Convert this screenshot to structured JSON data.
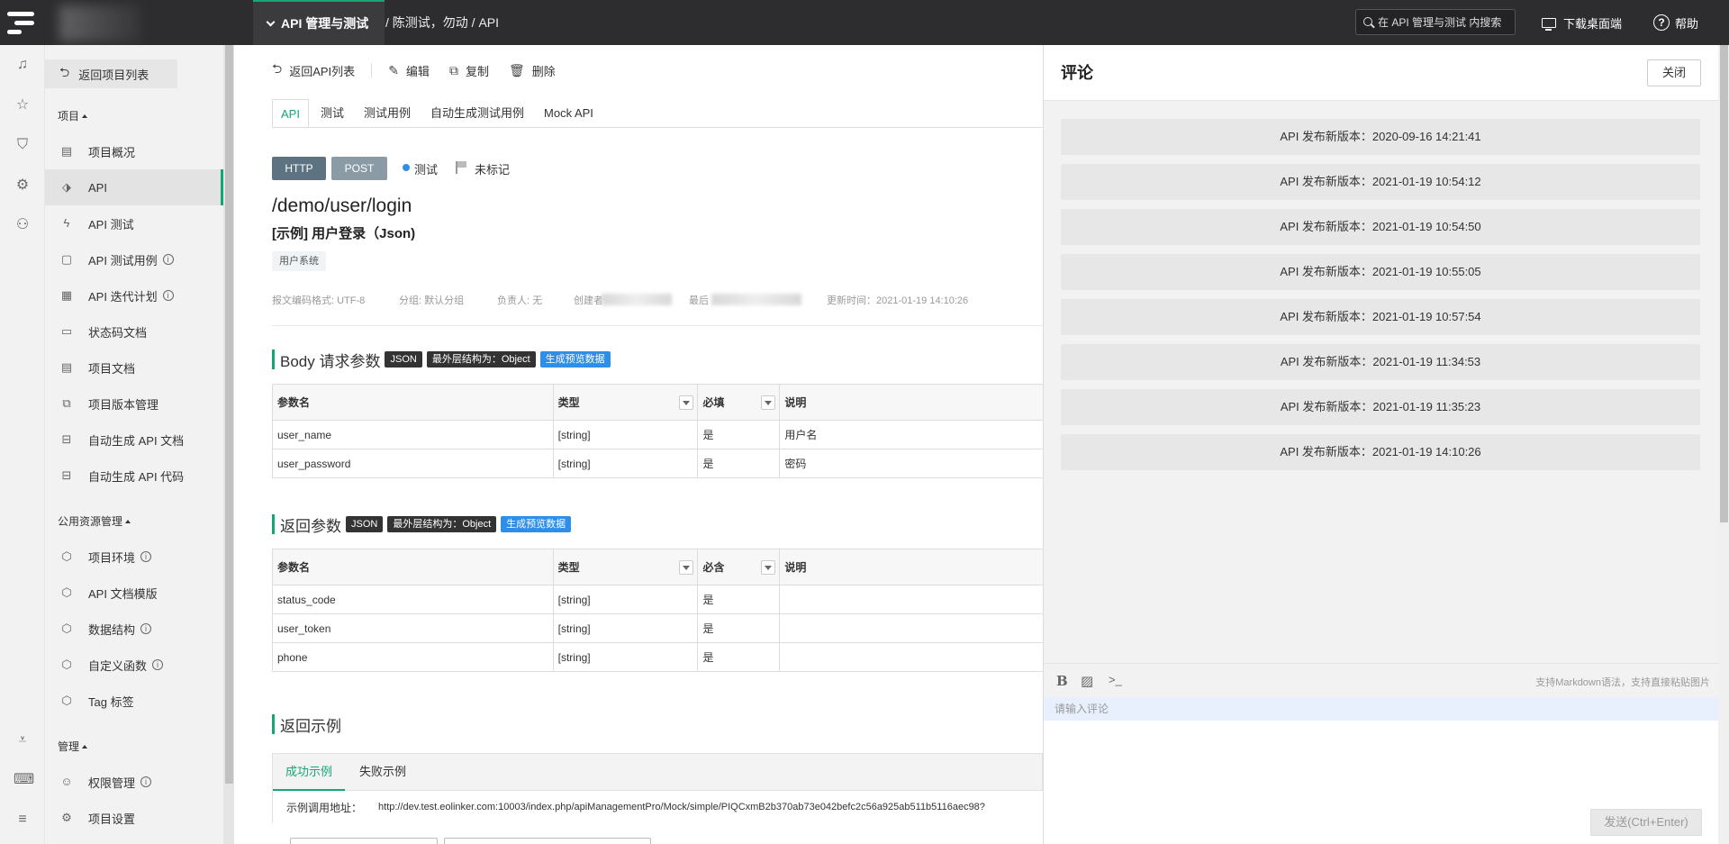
{
  "topbar": {
    "module": "API 管理与测试",
    "breadcrumb": "/ 陈测试，勿动 / API",
    "search_placeholder": "在 API 管理与测试 内搜索",
    "download_label": "下载桌面端",
    "help_label": "帮助"
  },
  "sidebar": {
    "back_label": "返回项目列表",
    "section_project": "项目",
    "section_resources": "公用资源管理",
    "section_manage": "管理",
    "items": [
      {
        "label": "项目概况",
        "info": false
      },
      {
        "label": "API",
        "info": false,
        "active": true
      },
      {
        "label": "API 测试",
        "info": false
      },
      {
        "label": "API 测试用例",
        "info": true
      },
      {
        "label": "API 迭代计划",
        "info": true
      },
      {
        "label": "状态码文档",
        "info": false
      },
      {
        "label": "项目文档",
        "info": false
      },
      {
        "label": "项目版本管理",
        "info": false
      },
      {
        "label": "自动生成 API 文档",
        "info": false
      },
      {
        "label": "自动生成 API 代码",
        "info": false
      }
    ],
    "resource_items": [
      {
        "label": "项目环境",
        "info": true
      },
      {
        "label": "API 文档模版",
        "info": false
      },
      {
        "label": "数据结构",
        "info": true
      },
      {
        "label": "自定义函数",
        "info": true
      },
      {
        "label": "Tag 标签",
        "info": false
      }
    ],
    "manage_items": [
      {
        "label": "权限管理",
        "info": true
      },
      {
        "label": "项目设置",
        "info": false
      }
    ]
  },
  "toolbar": {
    "back": "返回API列表",
    "edit": "编辑",
    "copy": "复制",
    "delete": "删除"
  },
  "tabs": [
    "API",
    "测试",
    "测试用例",
    "自动生成测试用例",
    "Mock API"
  ],
  "api": {
    "protocol": "HTTP",
    "method": "POST",
    "status": "测试",
    "mark": "未标记",
    "path": "/demo/user/login",
    "name": "[示例] 用户登录（Json)",
    "tag": "用户系统",
    "meta": {
      "encoding": "报文编码格式: UTF-8",
      "group": "分组: 默认分组",
      "owner": "负责人: 无",
      "creator": "创建者",
      "last": "最后",
      "updated": "更新时间：2021-01-19 14:10:26"
    }
  },
  "body_params": {
    "title": "Body 请求参数",
    "pills": [
      "JSON",
      "最外层结构为：Object",
      "生成预览数据"
    ],
    "headers": [
      "参数名",
      "类型",
      "必填",
      "说明"
    ],
    "rows": [
      [
        "user_name",
        "[string]",
        "是",
        "用户名"
      ],
      [
        "user_password",
        "[string]",
        "是",
        "密码"
      ]
    ]
  },
  "return_params": {
    "title": "返回参数",
    "pills": [
      "JSON",
      "最外层结构为：Object",
      "生成预览数据"
    ],
    "headers": [
      "参数名",
      "类型",
      "必含",
      "说明"
    ],
    "rows": [
      [
        "status_code",
        "[string]",
        "是",
        ""
      ],
      [
        "user_token",
        "[string]",
        "是",
        ""
      ],
      [
        "phone",
        "[string]",
        "是",
        ""
      ]
    ]
  },
  "example": {
    "title": "返回示例",
    "tabs": [
      "成功示例",
      "失败示例"
    ],
    "url_label": "示例调用地址：",
    "url": "http://dev.test.eolinker.com:10003/index.php/apiManagementPro/Mock/simple/PIQCxmB2b370ab73e042befc2c56a925ab511b5116aec98?"
  },
  "comments": {
    "title": "评论",
    "close_label": "关闭",
    "releases": [
      "API 发布新版本：2020-09-16 14:21:41",
      "API 发布新版本：2021-01-19 10:54:12",
      "API 发布新版本：2021-01-19 10:54:50",
      "API 发布新版本：2021-01-19 10:55:05",
      "API 发布新版本：2021-01-19 10:57:54",
      "API 发布新版本：2021-01-19 11:34:53",
      "API 发布新版本：2021-01-19 11:35:23",
      "API 发布新版本：2021-01-19 14:10:26"
    ],
    "editor_hint": "支持Markdown语法，支持直接粘贴图片",
    "input_placeholder": "请输入评论",
    "send_label": "发送(Ctrl+Enter)"
  },
  "colors": {
    "accent": "#17a673",
    "topbar": "#2d2d2f",
    "http_badge": "#5e7382",
    "post_badge": "#8b9ba6",
    "blue_pill": "#2f8fe8"
  }
}
